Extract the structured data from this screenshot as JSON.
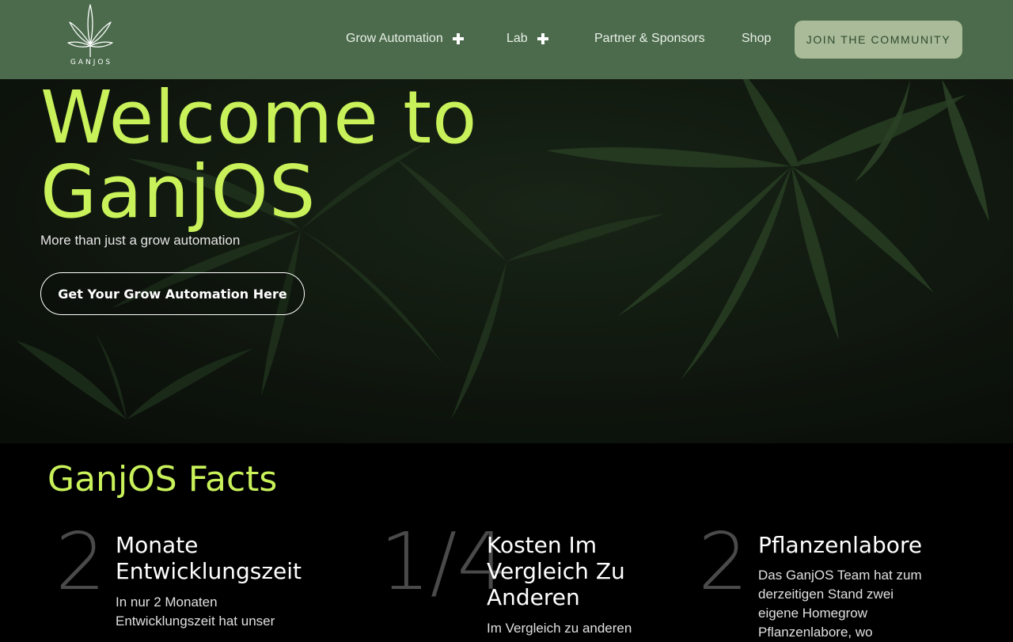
{
  "header": {
    "logo_text": "GANJOS",
    "nav": [
      {
        "label": "Grow Automation",
        "has_submenu": true
      },
      {
        "label": "Lab",
        "has_submenu": true
      },
      {
        "label": "Partner & Sponsors",
        "has_submenu": false
      },
      {
        "label": "Shop",
        "has_submenu": false
      }
    ],
    "join_label": "JOIN THE COMMUNITY"
  },
  "hero": {
    "title_line1": "Welcome to",
    "title_line2": "GanjOS",
    "subtitle": "More than just a grow automation",
    "cta_label": "Get Your Grow Automation Here"
  },
  "facts": {
    "title": "GanjOS Facts",
    "items": [
      {
        "number": "2",
        "heading_line1": "Monate",
        "heading_line2": "Entwicklungszeit",
        "heading_line3": "",
        "text_line1": "In nur 2 Monaten",
        "text_line2": "Entwicklungszeit hat unser"
      },
      {
        "number": "1/4",
        "heading_line1": "Kosten Im",
        "heading_line2": "Vergleich Zu",
        "heading_line3": "Anderen",
        "text_line1": "Im Vergleich zu anderen",
        "text_line2": ""
      },
      {
        "number": "2",
        "heading_line1": "Pflanzenlabore",
        "heading_line2": "",
        "heading_line3": "",
        "text_line1": "Das GanjOS Team hat zum",
        "text_line2": "derzeitigen Stand zwei",
        "text_line3": "eigene Homegrow",
        "text_line4": "Pflanzenlabore, wo"
      }
    ]
  },
  "colors": {
    "header_bg": "#4b6b4c",
    "accent": "#c8f15a",
    "join_button_bg": "#a9bb98",
    "page_bg": "#000000"
  }
}
